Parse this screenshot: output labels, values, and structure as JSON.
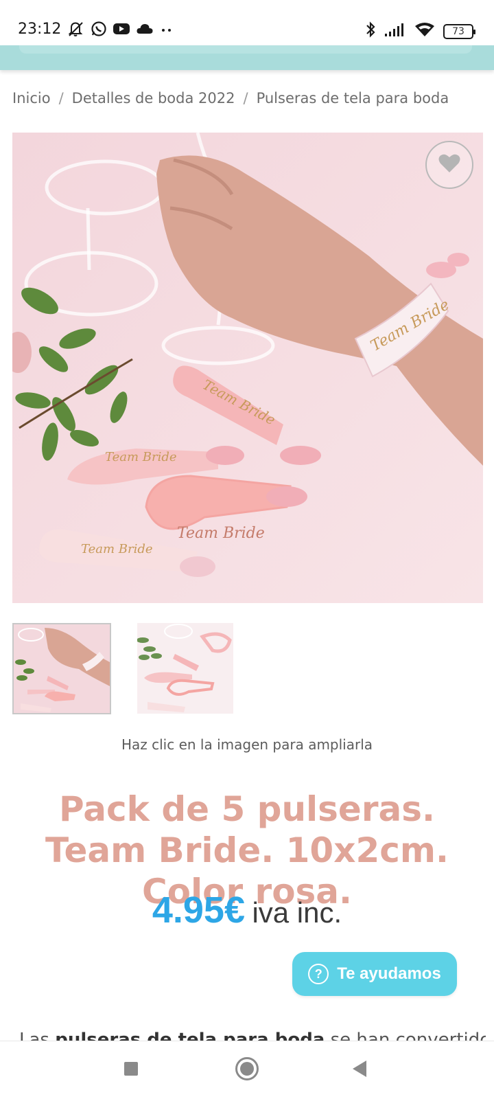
{
  "status_bar": {
    "time": "23:12",
    "battery": "73",
    "left_icons": [
      "mute-bell-icon",
      "whatsapp-icon",
      "youtube-icon",
      "cloud-icon",
      "more-dots-icon"
    ],
    "right_icons": [
      "bluetooth-icon",
      "signal-icon",
      "wifi-icon",
      "battery-icon"
    ]
  },
  "breadcrumb": {
    "items": [
      "Inicio",
      "Detalles de boda 2022",
      "Pulseras de tela para boda"
    ],
    "separator": "/"
  },
  "product": {
    "title": "Pack de 5 pulseras. Team Bride. 10x2cm. Color rosa.",
    "price": "4.95€",
    "price_suffix": "iva inc.",
    "zoom_hint": "Haz clic en la imagen para ampliarla",
    "image_text": "Team Bride"
  },
  "help_button": {
    "label": "Te ayudamos",
    "icon": "?"
  },
  "description": {
    "start": "Las ",
    "bold": "pulseras de tela para boda",
    "end": " se han convertido"
  },
  "colors": {
    "header": "#a9dcdb",
    "title": "#e0a598",
    "price": "#2da6e6",
    "help_button": "#5dd2e6"
  }
}
